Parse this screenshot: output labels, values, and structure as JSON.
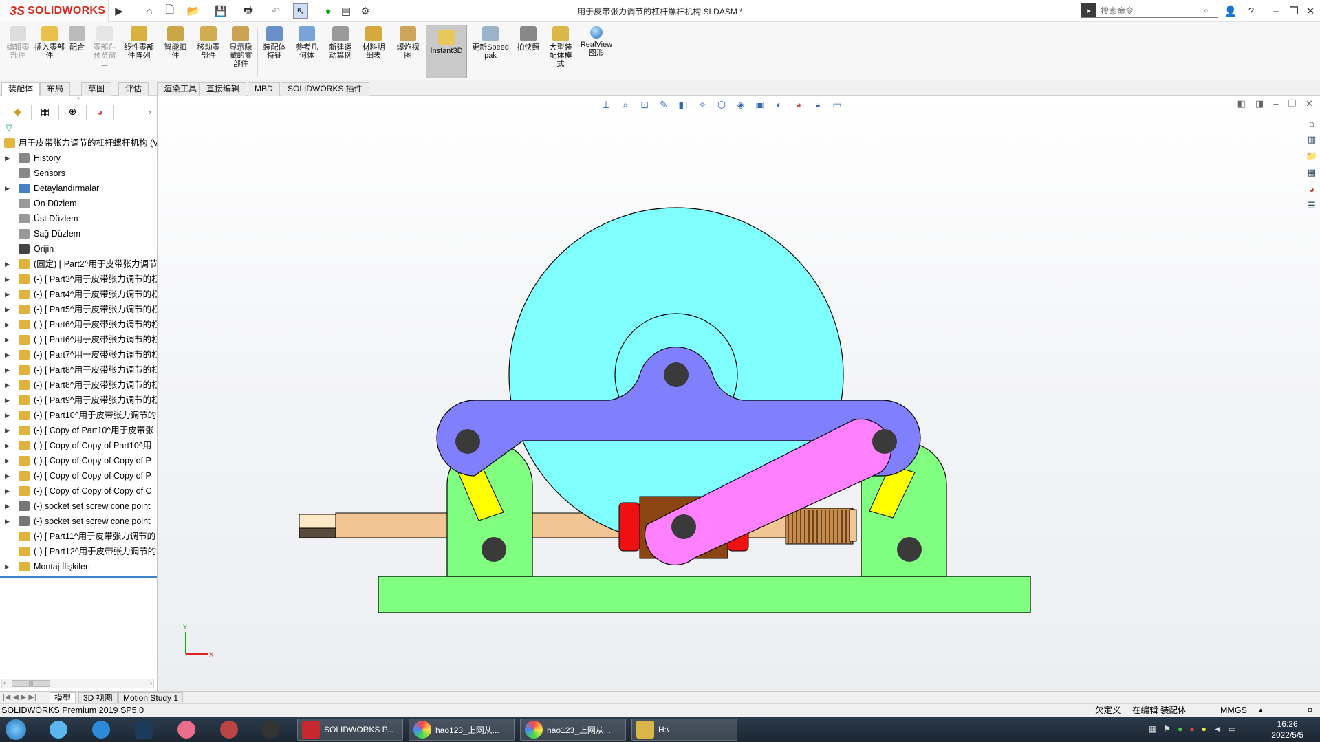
{
  "app": {
    "title": "用于皮带张力调节的杠杆螺杆机构.SLDASM *",
    "logo_text": "SOLIDWORKS",
    "logo_mark": "3S"
  },
  "search": {
    "placeholder": "搜索命令"
  },
  "ribbon": {
    "buttons": [
      {
        "label": "编辑零部件",
        "disabled": true
      },
      {
        "label": "插入零部件"
      },
      {
        "label": "配合"
      },
      {
        "label": "零部件预览窗口",
        "disabled": true
      },
      {
        "label": "线性零部件阵列"
      },
      {
        "label": "智能扣件"
      },
      {
        "label": "移动零部件"
      },
      {
        "label": "显示隐藏的零部件"
      },
      {
        "label": "装配体特征"
      },
      {
        "label": "参考几何体"
      },
      {
        "label": "新建运动算例"
      },
      {
        "label": "材料明细表"
      },
      {
        "label": "爆炸视图"
      },
      {
        "label": "Instant3D"
      },
      {
        "label": "更新Speedpak"
      },
      {
        "label": "拍快照"
      },
      {
        "label": "大型装配体模式"
      },
      {
        "label": "RealView图形"
      }
    ]
  },
  "tabs": [
    "装配体",
    "布局",
    "草图",
    "评估",
    "渲染工具",
    "直接编辑",
    "MBD",
    "SOLIDWORKS 插件"
  ],
  "tree": {
    "root": "用于皮带张力调节的杠杆螺杆机构  (V",
    "items": [
      {
        "label": "History",
        "arrow": true
      },
      {
        "label": "Sensors",
        "arrow": false
      },
      {
        "label": "Detaylandırmalar",
        "arrow": true
      },
      {
        "label": "Ön Düzlem",
        "arrow": false
      },
      {
        "label": "Üst Düzlem",
        "arrow": false
      },
      {
        "label": "Sağ Düzlem",
        "arrow": false
      },
      {
        "label": "Orijin",
        "arrow": false
      },
      {
        "label": "(固定) [ Part2^用于皮带张力调节",
        "arrow": true
      },
      {
        "label": "(-) [ Part3^用于皮带张力调节的杠",
        "arrow": true
      },
      {
        "label": "(-) [ Part4^用于皮带张力调节的杠",
        "arrow": true
      },
      {
        "label": "(-) [ Part5^用于皮带张力调节的杠",
        "arrow": true
      },
      {
        "label": "(-) [ Part6^用于皮带张力调节的杠",
        "arrow": true
      },
      {
        "label": "(-) [ Part6^用于皮带张力调节的杠",
        "arrow": true
      },
      {
        "label": "(-) [ Part7^用于皮带张力调节的杠",
        "arrow": true
      },
      {
        "label": "(-) [ Part8^用于皮带张力调节的杠",
        "arrow": true
      },
      {
        "label": "(-) [ Part8^用于皮带张力调节的杠",
        "arrow": true
      },
      {
        "label": "(-) [ Part9^用于皮带张力调节的杠",
        "arrow": true
      },
      {
        "label": "(-) [ Part10^用于皮带张力调节的",
        "arrow": true
      },
      {
        "label": "(-) [ Copy of Part10^用于皮带张",
        "arrow": true
      },
      {
        "label": "(-) [ Copy of Copy of Part10^用",
        "arrow": true
      },
      {
        "label": "(-) [ Copy of Copy of Copy of P",
        "arrow": true
      },
      {
        "label": "(-) [ Copy of Copy of Copy of P",
        "arrow": true
      },
      {
        "label": "(-) [ Copy of Copy of Copy of C",
        "arrow": true
      },
      {
        "label": "(-) socket set screw cone point",
        "arrow": true
      },
      {
        "label": "(-) socket set screw cone point",
        "arrow": true
      },
      {
        "label": "(-) [ Part11^用于皮带张力调节的",
        "arrow": false
      },
      {
        "label": "(-) [ Part12^用于皮带张力调节的",
        "arrow": false
      },
      {
        "label": "Montaj İlişkileri",
        "arrow": true
      }
    ]
  },
  "bottom_tabs": [
    "模型",
    "3D 视图",
    "Motion Study 1"
  ],
  "status": {
    "left": "SOLIDWORKS Premium 2019 SP5.0",
    "undefined": "欠定义",
    "editing": "在编辑 装配体",
    "units": "MMGS"
  },
  "taskbar": {
    "apps": [
      {
        "label": "SOLIDWORKS P...",
        "color": "#c8282d"
      },
      {
        "label": "hao123_上网从...",
        "color": "#3aa0e8"
      },
      {
        "label": "hao123_上网从...",
        "color": "#3aa0e8"
      },
      {
        "label": "H:\\",
        "color": "#d9b54a"
      }
    ],
    "time": "16:26",
    "date": "2022/5/5"
  },
  "colors": {
    "wheel": "#80ffff",
    "lever": "#8080ff",
    "link": "#ff80ff",
    "support": "#80ff80",
    "stub": "#ffff00",
    "screw": "#ffd3a6",
    "collar": "#ee1111",
    "block": "#8b4513"
  }
}
